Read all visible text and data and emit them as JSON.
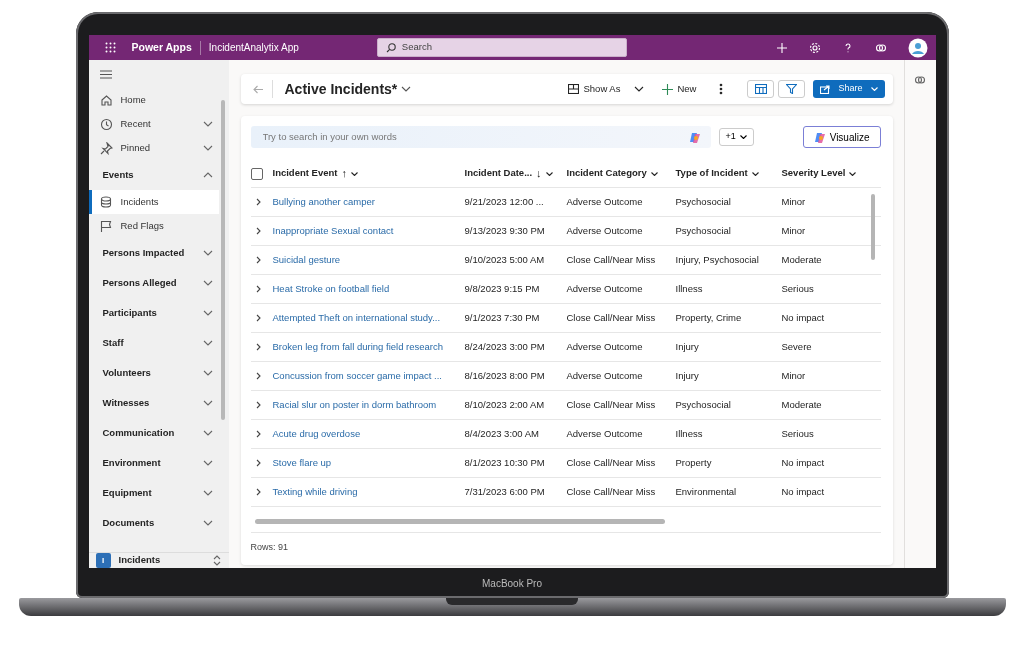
{
  "topbar": {
    "product": "Power Apps",
    "app_name": "IncidentAnalytix App",
    "search": {
      "placeholder": "Search"
    }
  },
  "sidebar": {
    "items": [
      {
        "kind": "link",
        "label": "Home",
        "selected": false
      },
      {
        "kind": "link",
        "label": "Recent",
        "selected": false,
        "expanded": false
      },
      {
        "kind": "link",
        "label": "Pinned",
        "selected": false,
        "expanded": false
      },
      {
        "kind": "group",
        "label": "Events",
        "expanded": true,
        "children": [
          {
            "label": "Incidents",
            "selected": true
          },
          {
            "label": "Red Flags",
            "selected": false
          }
        ]
      },
      {
        "kind": "group",
        "label": "Persons Impacted",
        "expanded": false
      },
      {
        "kind": "group",
        "label": "Persons Alleged",
        "expanded": false
      },
      {
        "kind": "group",
        "label": "Participants",
        "expanded": false
      },
      {
        "kind": "group",
        "label": "Staff",
        "expanded": false
      },
      {
        "kind": "group",
        "label": "Volunteers",
        "expanded": false
      },
      {
        "kind": "group",
        "label": "Witnesses",
        "expanded": false
      },
      {
        "kind": "group",
        "label": "Communication",
        "expanded": false
      },
      {
        "kind": "group",
        "label": "Environment",
        "expanded": false
      },
      {
        "kind": "group",
        "label": "Equipment",
        "expanded": false
      },
      {
        "kind": "group",
        "label": "Documents",
        "expanded": false
      }
    ],
    "area": {
      "initial": "I",
      "label": "Incidents"
    }
  },
  "command_bar": {
    "title": "Active Incidents*",
    "show_as": "Show As",
    "new": "New",
    "share": "Share"
  },
  "grid": {
    "search": {
      "placeholder": "Try to search in your own words"
    },
    "filter_count": "+1",
    "visualize": "Visualize",
    "table": {
      "select_all_checked": false,
      "columns": [
        {
          "label": "Incident Event",
          "sort": "↑"
        },
        {
          "label": "Incident Date...",
          "sort": "↓"
        },
        {
          "label": "Incident Category"
        },
        {
          "label": "Type of Incident"
        },
        {
          "label": "Severity Level"
        }
      ],
      "rows": [
        {
          "event": "Bullying another camper",
          "date": "9/21/2023 12:00 ...",
          "category": "Adverse Outcome",
          "type": "Psychosocial",
          "severity": "Minor"
        },
        {
          "event": "Inappropriate Sexual contact",
          "date": "9/13/2023 9:30 PM",
          "category": "Adverse Outcome",
          "type": "Psychosocial",
          "severity": "Minor"
        },
        {
          "event": "Suicidal gesture",
          "date": "9/10/2023 5:00 AM",
          "category": "Close Call/Near Miss",
          "type": "Injury, Psychosocial",
          "severity": "Moderate"
        },
        {
          "event": "Heat Stroke on football field",
          "date": "9/8/2023 9:15 PM",
          "category": "Adverse Outcome",
          "type": "Illness",
          "severity": "Serious"
        },
        {
          "event": "Attempted Theft on international study...",
          "date": "9/1/2023 7:30 PM",
          "category": "Close Call/Near Miss",
          "type": "Property, Crime",
          "severity": "No impact"
        },
        {
          "event": "Broken leg from fall during field research",
          "date": "8/24/2023 3:00 PM",
          "category": "Adverse Outcome",
          "type": "Injury",
          "severity": "Severe"
        },
        {
          "event": "Concussion from soccer game impact ...",
          "date": "8/16/2023 8:00 PM",
          "category": "Adverse Outcome",
          "type": "Injury",
          "severity": "Minor"
        },
        {
          "event": "Racial slur on poster in dorm bathroom",
          "date": "8/10/2023 2:00 AM",
          "category": "Close Call/Near Miss",
          "type": "Psychosocial",
          "severity": "Moderate"
        },
        {
          "event": "Acute drug overdose",
          "date": "8/4/2023 3:00 AM",
          "category": "Adverse Outcome",
          "type": "Illness",
          "severity": "Serious"
        },
        {
          "event": "Stove flare up",
          "date": "8/1/2023 10:30 PM",
          "category": "Close Call/Near Miss",
          "type": "Property",
          "severity": "No impact"
        },
        {
          "event": "Texting while driving",
          "date": "7/31/2023 6:00 PM",
          "category": "Close Call/Near Miss",
          "type": "Environmental",
          "severity": "No impact"
        }
      ]
    },
    "footer": "Rows: 91"
  },
  "laptop": {
    "label": "MacBook Pro"
  }
}
